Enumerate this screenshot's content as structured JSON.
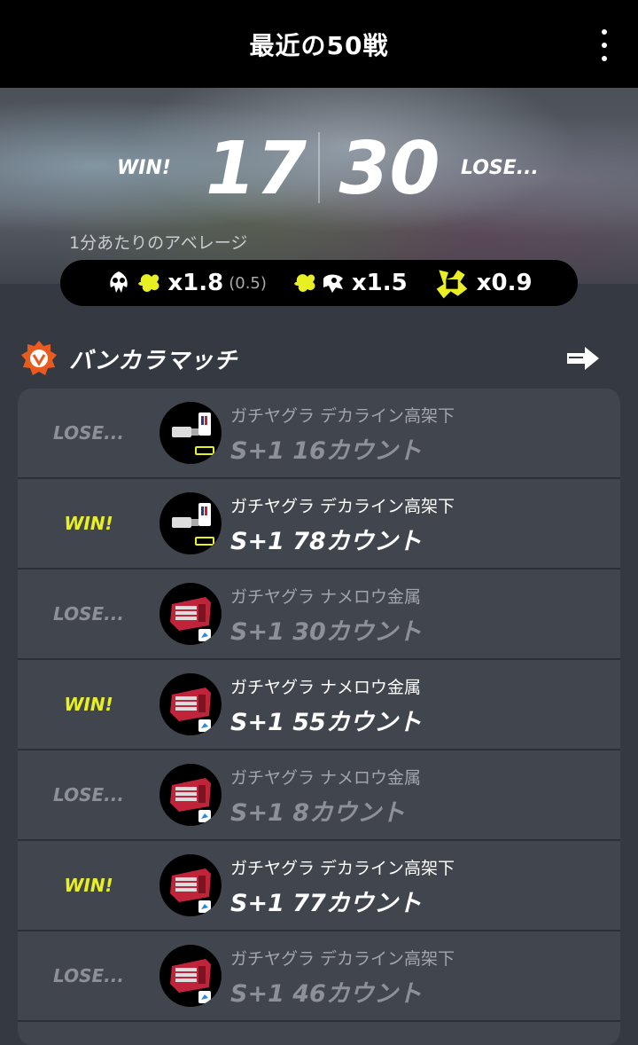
{
  "header": {
    "title": "最近の50戦"
  },
  "summary": {
    "win_label": "WIN!",
    "win_count": "17",
    "lose_count": "30",
    "lose_label": "LOSE...",
    "average_label": "1分あたりのアベレージ"
  },
  "stats": {
    "kill_assist": "x1.8",
    "assist": "(0.5)",
    "death": "x1.5",
    "special": "x0.9"
  },
  "section": {
    "title": "バンカラマッチ"
  },
  "matches": [
    {
      "result": "LOSE...",
      "stage": "ガチヤグラ デカライン高架下",
      "rank": "S+1 16カウント",
      "weapon": "sploosh"
    },
    {
      "result": "WIN!",
      "stage": "ガチヤグラ デカライン高架下",
      "rank": "S+1 78カウント",
      "weapon": "sploosh"
    },
    {
      "result": "LOSE...",
      "stage": "ガチヤグラ ナメロウ金属",
      "rank": "S+1 30カウント",
      "weapon": "gatling"
    },
    {
      "result": "WIN!",
      "stage": "ガチヤグラ ナメロウ金属",
      "rank": "S+1 55カウント",
      "weapon": "gatling"
    },
    {
      "result": "LOSE...",
      "stage": "ガチヤグラ ナメロウ金属",
      "rank": "S+1 8カウント",
      "weapon": "gatling"
    },
    {
      "result": "WIN!",
      "stage": "ガチヤグラ デカライン高架下",
      "rank": "S+1 77カウント",
      "weapon": "gatling"
    },
    {
      "result": "LOSE...",
      "stage": "ガチヤグラ デカライン高架下",
      "rank": "S+1 46カウント",
      "weapon": "gatling"
    }
  ],
  "colors": {
    "win": "#e8ef22",
    "lose": "#8d9096",
    "accent": "#e85a1e"
  }
}
